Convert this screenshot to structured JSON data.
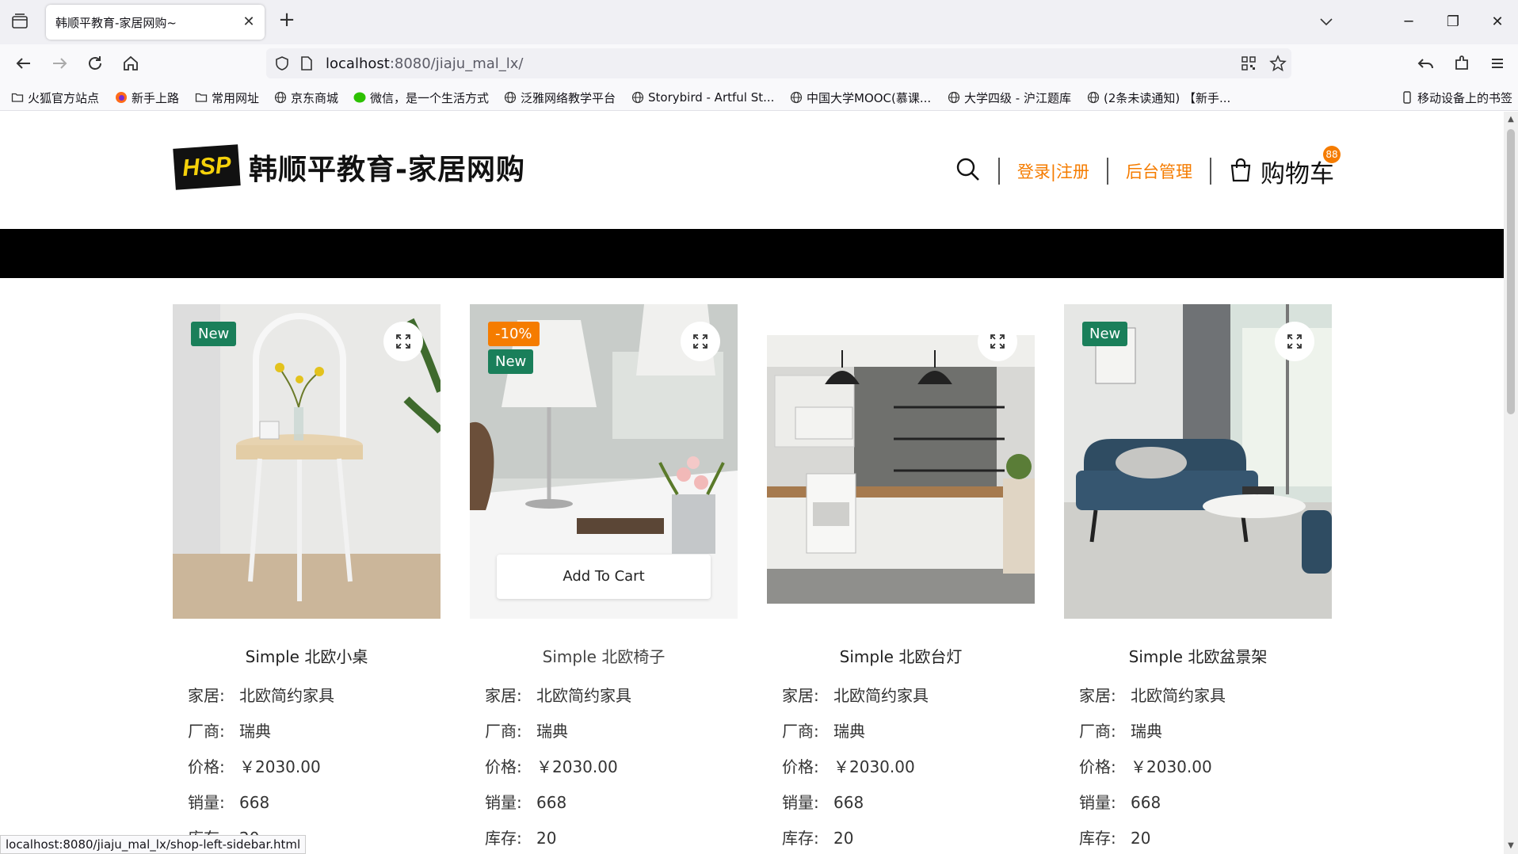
{
  "browser": {
    "tab": {
      "title": "韩顺平教育-家居网购~"
    },
    "url": {
      "host": "localhost",
      "rest": ":8080/jiaju_mal_lx/"
    },
    "bookmarks": [
      {
        "label": "火狐官方站点",
        "icon": "folder-icon"
      },
      {
        "label": "新手上路",
        "icon": "firefox-icon"
      },
      {
        "label": "常用网址",
        "icon": "folder-icon"
      },
      {
        "label": "京东商城",
        "icon": "globe-icon"
      },
      {
        "label": "微信，是一个生活方式",
        "icon": "wechat-icon"
      },
      {
        "label": "泛雅网络教学平台",
        "icon": "globe-icon"
      },
      {
        "label": "Storybird - Artful St...",
        "icon": "globe-icon"
      },
      {
        "label": "中国大学MOOC(慕课...",
        "icon": "globe-icon"
      },
      {
        "label": "大学四级 - 沪江题库",
        "icon": "globe-icon"
      },
      {
        "label": "(2条未读通知) 【新手...",
        "icon": "globe-icon"
      }
    ],
    "mobile_bookmarks": "移动设备上的书签",
    "status_url": "localhost:8080/jiaju_mal_lx/shop-left-sidebar.html"
  },
  "header": {
    "logo_badge": "HSP",
    "logo_text": "韩顺平教育-家居网购",
    "login_register": "登录|注册",
    "admin": "后台管理",
    "cart_label": "购物车",
    "cart_count": "88"
  },
  "products": [
    {
      "name": "Simple 北欧小桌",
      "badges": [
        "New"
      ],
      "add_to_cart": "",
      "category_key": "家居:",
      "category": "北欧简约家具",
      "maker_key": "厂商:",
      "maker": "瑞典",
      "price_key": "价格:",
      "price": "￥2030.00",
      "sales_key": "销量:",
      "sales": "668",
      "stock_key": "库存:",
      "stock": "20"
    },
    {
      "name": "Simple 北欧椅子",
      "badges": [
        "-10%",
        "New"
      ],
      "add_to_cart": "Add To Cart",
      "category_key": "家居:",
      "category": "北欧简约家具",
      "maker_key": "厂商:",
      "maker": "瑞典",
      "price_key": "价格:",
      "price": "￥2030.00",
      "sales_key": "销量:",
      "sales": "668",
      "stock_key": "库存:",
      "stock": "20"
    },
    {
      "name": "Simple 北欧台灯",
      "badges": [],
      "add_to_cart": "",
      "category_key": "家居:",
      "category": "北欧简约家具",
      "maker_key": "厂商:",
      "maker": "瑞典",
      "price_key": "价格:",
      "price": "￥2030.00",
      "sales_key": "销量:",
      "sales": "668",
      "stock_key": "库存:",
      "stock": "20"
    },
    {
      "name": "Simple 北欧盆景架",
      "badges": [
        "New"
      ],
      "add_to_cart": "",
      "category_key": "家居:",
      "category": "北欧简约家具",
      "maker_key": "厂商:",
      "maker": "瑞典",
      "price_key": "价格:",
      "price": "￥2030.00",
      "sales_key": "销量:",
      "sales": "668",
      "stock_key": "库存:",
      "stock": "20"
    }
  ],
  "colors": {
    "accent": "#f57c00",
    "new_badge": "#1a7f5a",
    "band": "#000000"
  }
}
